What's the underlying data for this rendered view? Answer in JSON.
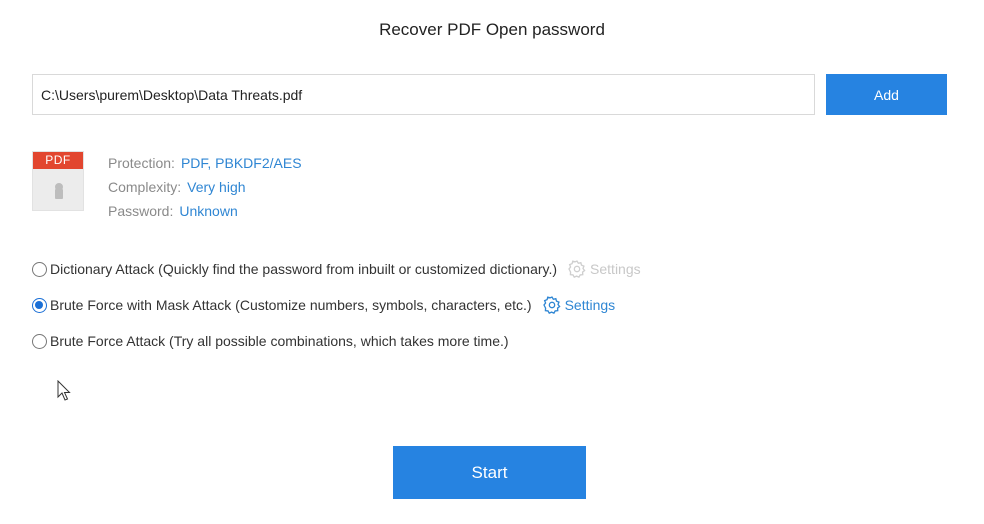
{
  "header": {
    "title": "Recover PDF Open password"
  },
  "file": {
    "path": "C:\\Users\\purem\\Desktop\\Data Threats.pdf",
    "add_label": "Add",
    "icon_text": "PDF"
  },
  "info": {
    "protection_label": "Protection:",
    "protection_value": "PDF, PBKDF2/AES",
    "complexity_label": "Complexity:",
    "complexity_value": "Very high",
    "password_label": "Password:",
    "password_value": "Unknown"
  },
  "attacks": [
    {
      "label": "Dictionary Attack (Quickly find the password from inbuilt or customized dictionary.)",
      "selected": false,
      "settings_label": "Settings",
      "settings_enabled": false
    },
    {
      "label": "Brute Force with Mask Attack (Customize numbers, symbols, characters, etc.)",
      "selected": true,
      "settings_label": "Settings",
      "settings_enabled": true
    },
    {
      "label": "Brute Force Attack (Try all possible combinations, which takes more time.)",
      "selected": false
    }
  ],
  "footer": {
    "start_label": "Start"
  },
  "colors": {
    "accent": "#2683e1",
    "link": "#2f86d3",
    "pdf_red": "#e2462f",
    "disabled": "#c8c8c8"
  },
  "icons": [
    "pdf-file-icon",
    "lock-icon",
    "gear-icon",
    "mouse-cursor-icon"
  ]
}
